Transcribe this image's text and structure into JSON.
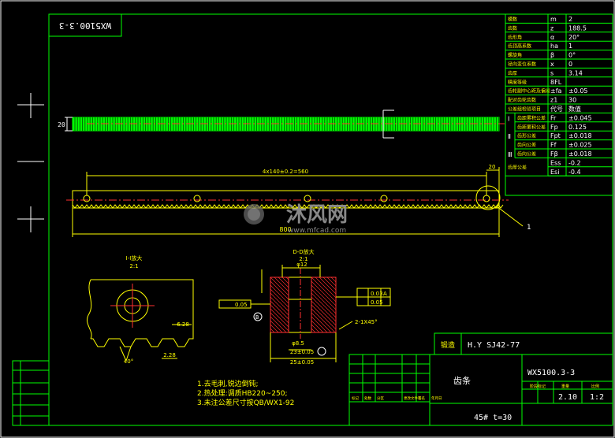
{
  "drawing": {
    "code_box": "WX5100.3-3",
    "code_main": "WX5100.3-3",
    "part_name": "齿条",
    "material_note": "45# t=30",
    "standard_label": "锻造",
    "standard_value": "H.Y SJ42-77",
    "scale": "1:2",
    "weight": "2.10",
    "title_small": [
      "标记",
      "处数",
      "分区",
      "更改文件号",
      "签名",
      "年月日"
    ],
    "stage_labels": [
      "阶段标记",
      "重量",
      "比例"
    ]
  },
  "params": [
    {
      "name": "模数",
      "sym": "m",
      "val": "2"
    },
    {
      "name": "齿数",
      "sym": "z",
      "val": "188.5"
    },
    {
      "name": "齿形角",
      "sym": "α",
      "val": "20°"
    },
    {
      "name": "齿顶高系数",
      "sym": "ha",
      "val": "1"
    },
    {
      "name": "螺旋角",
      "sym": "β",
      "val": "0°"
    },
    {
      "name": "径向变位系数",
      "sym": "x",
      "val": "0"
    },
    {
      "name": "齿厚",
      "sym": "s",
      "val": "3.14"
    },
    {
      "name": "精度等级",
      "sym": "8FL",
      "val": ""
    },
    {
      "name": "齿轮副中心距及偏差",
      "sym": "±fa",
      "val": "±0.05"
    },
    {
      "name": "配对齿轮齿数",
      "sym": "z1",
      "val": "30"
    },
    {
      "name": "公差组检验项目",
      "sym": "代号",
      "val": "数值"
    }
  ],
  "tolerance_rows": [
    {
      "group": "Ⅰ",
      "name": "齿距累积公差",
      "sym": "Fr",
      "val": "±0.045"
    },
    {
      "group": "",
      "name": "齿距累积公差",
      "sym": "Fp",
      "val": "0.125"
    },
    {
      "group": "Ⅱ",
      "name": "齿形公差",
      "sym": "Fpt",
      "val": "±0.018"
    },
    {
      "group": "",
      "name": "齿向公差",
      "sym": "Ff",
      "val": "±0.025"
    },
    {
      "group": "Ⅲ",
      "name": "齿向公差",
      "sym": "Fβ",
      "val": "±0.018"
    }
  ],
  "thickness_dev": {
    "label": "齿厚公差",
    "rows": [
      {
        "sym": "Ess",
        "val": "-0.2"
      },
      {
        "sym": "Esi",
        "val": "-0.4"
      }
    ]
  },
  "notes": [
    "1.去毛刺,锐边倒钝;",
    "2.热处理:调质HB220~250;",
    "3.未注公差尺寸按QB/WX1-92"
  ],
  "dims": {
    "hole_spacing": "4x140±0.2=560",
    "length": "800",
    "end_offset": "20",
    "height": "20",
    "leader_1": "1",
    "section_title": "D-D放大",
    "section_scale": "2:1",
    "detail_title": "I-I放大",
    "detail_scale": "2:1",
    "bore": "φ12",
    "width": "25±0.05",
    "depth": "23±0.05",
    "counter": "φ8.5",
    "chamfer": "2-1X45°",
    "pitch_dim": "6.28",
    "tooth_h": "2.28",
    "angle": "40°",
    "gdt_1": "0.03",
    "gdt_2": "0.05",
    "gdt_3": "0.05",
    "datum_a": "A",
    "datum_b": "B"
  },
  "watermark": {
    "brand": "沐风网",
    "url": "www.mfcad.com"
  }
}
